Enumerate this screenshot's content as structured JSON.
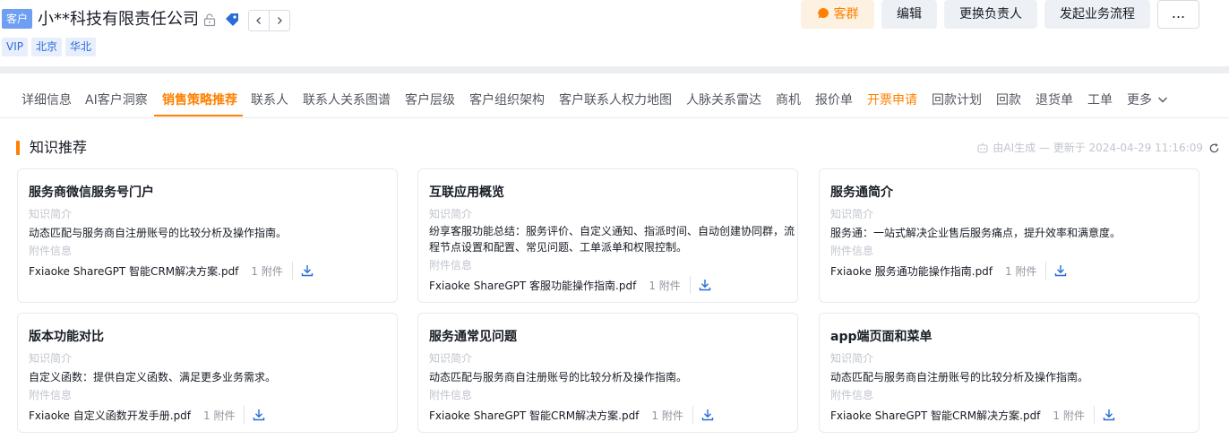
{
  "header": {
    "type_badge": "客户",
    "company_name": "小**科技有限责任公司",
    "tags": [
      "VIP",
      "北京",
      "华北"
    ],
    "actions": {
      "group_chat": "客群",
      "edit": "编辑",
      "change_owner": "更换负责人",
      "start_flow": "发起业务流程",
      "more": "..."
    }
  },
  "tabs": [
    "详细信息",
    "AI客户洞察",
    "销售策略推荐",
    "联系人",
    "联系人关系图谱",
    "客户层级",
    "客户组织架构",
    "客户联系人权力地图",
    "人脉关系雷达",
    "商机",
    "报价单",
    "开票申请",
    "回款计划",
    "回款",
    "退货单",
    "工单",
    "更多"
  ],
  "active_tab": "销售策略推荐",
  "section": {
    "title": "知识推荐",
    "ai_note": "由AI生成 — 更新于 2024-04-29 11:16:09"
  },
  "labels": {
    "summary": "知识简介",
    "attachment": "附件信息"
  },
  "cards": [
    {
      "title": "服务商微信服务号门户",
      "desc": "动态匹配与服务商自注册账号的比较分析及操作指南。",
      "file": "Fxiaoke ShareGPT 智能CRM解决方案.pdf",
      "count": "1 附件"
    },
    {
      "title": "互联应用概览",
      "desc": "纷享客服功能总结：服务评价、自定义通知、指派时间、自动创建协同群，流程节点设置和配置、常见问题、工单派单和权限控制。",
      "file": "Fxiaoke ShareGPT 客服功能操作指南.pdf",
      "count": "1 附件"
    },
    {
      "title": "服务通简介",
      "desc": "服务通：一站式解决企业售后服务痛点，提升效率和满意度。",
      "file": "Fxiaoke 服务通功能操作指南.pdf",
      "count": "1 附件"
    },
    {
      "title": "版本功能对比",
      "desc": "自定义函数：提供自定义函数、满足更多业务需求。",
      "file": "Fxiaoke 自定义函数开发手册.pdf",
      "count": "1 附件"
    },
    {
      "title": "服务通常见问题",
      "desc": "动态匹配与服务商自注册账号的比较分析及操作指南。",
      "file": "Fxiaoke ShareGPT 智能CRM解决方案.pdf",
      "count": "1 附件"
    },
    {
      "title": "app端页面和菜单",
      "desc": "动态匹配与服务商自注册账号的比较分析及操作指南。",
      "file": "Fxiaoke ShareGPT 智能CRM解决方案.pdf",
      "count": "1 附件"
    }
  ],
  "colors": {
    "accent": "#ff8000",
    "badge": "#6e9ff3",
    "link_blue": "#2b6ad9"
  }
}
